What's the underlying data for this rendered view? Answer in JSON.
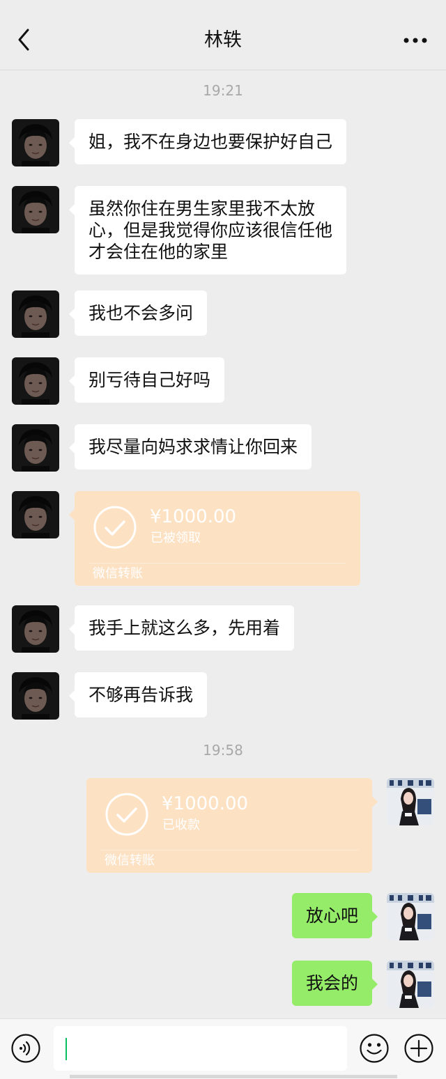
{
  "header": {
    "title": "林轶",
    "back_icon": "chevron-left-icon",
    "more_icon": "more-dots-icon"
  },
  "timestamps": [
    "19:21",
    "19:58"
  ],
  "messages": [
    {
      "side": "left",
      "type": "text",
      "lines": [
        "姐，我不在身边也要保护好自己"
      ]
    },
    {
      "side": "left",
      "type": "text",
      "lines": [
        "虽然你住在男生家里我不太放",
        "心，但是我觉得你应该很信任他",
        "才会住在他的家里"
      ]
    },
    {
      "side": "left",
      "type": "text",
      "lines": [
        "我也不会多问"
      ]
    },
    {
      "side": "left",
      "type": "text",
      "lines": [
        "别亏待自己好吗"
      ]
    },
    {
      "side": "left",
      "type": "text",
      "lines": [
        "我尽量向妈求求情让你回来"
      ]
    },
    {
      "side": "left",
      "type": "transfer",
      "amount": "¥1000.00",
      "status": "已被领取",
      "footer": "微信转账"
    },
    {
      "side": "left",
      "type": "text",
      "lines": [
        "我手上就这么多，先用着"
      ]
    },
    {
      "side": "left",
      "type": "text",
      "lines": [
        "不够再告诉我"
      ]
    },
    {
      "side": "right",
      "type": "transfer",
      "amount": "¥1000.00",
      "status": "已收款",
      "footer": "微信转账"
    },
    {
      "side": "right",
      "type": "text",
      "lines": [
        "放心吧"
      ]
    },
    {
      "side": "right",
      "type": "text",
      "lines": [
        "我会的"
      ]
    }
  ],
  "input_bar": {
    "voice_icon": "voice-icon",
    "emoji_icon": "emoji-icon",
    "plus_icon": "plus-icon",
    "input_value": ""
  },
  "colors": {
    "background": "#ededed",
    "incoming_bubble": "#ffffff",
    "outgoing_bubble": "#95ec69",
    "transfer_card": "#fde1c3",
    "caret": "#07c160"
  }
}
